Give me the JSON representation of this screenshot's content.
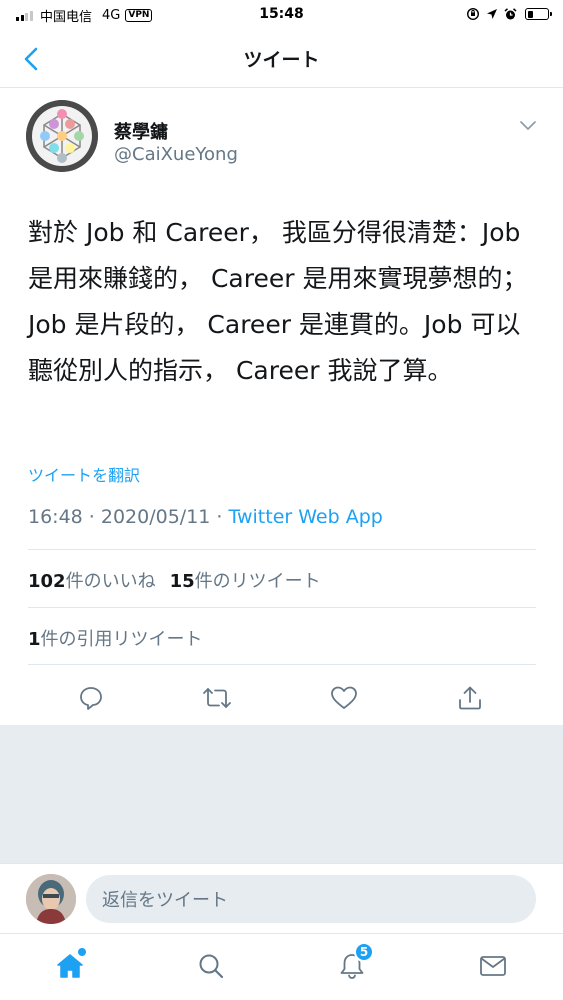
{
  "status_bar": {
    "carrier": "中国电信",
    "network": "4G",
    "vpn": "VPN",
    "time": "15:48"
  },
  "header": {
    "title": "ツイート",
    "back_icon": "chevron-left-icon"
  },
  "tweet": {
    "author_name": "蔡學鏞",
    "author_handle": "@CaiXueYong",
    "text": "對於 Job 和 Career， 我區分得很清楚：Job 是用來賺錢的， Career 是用來實現夢想的；Job 是片段的， Career 是連貫的。Job 可以聽從別人的指示， Career 我說了算。",
    "translate_label": "ツイートを翻訳",
    "timestamp": "16:48 · 2020/05/11 · ",
    "source": "Twitter Web App",
    "likes_count": "102",
    "likes_label": "件のいいね",
    "retweets_count": "15",
    "retweets_label": "件のリツイート",
    "quotes_count": "1",
    "quotes_label": "件の引用リツイート"
  },
  "actions": [
    "reply-icon",
    "retweet-icon",
    "like-icon",
    "share-icon"
  ],
  "reply": {
    "placeholder": "返信をツイート"
  },
  "tab_bar": {
    "items": [
      "home-icon",
      "search-icon",
      "notifications-icon",
      "messages-icon"
    ],
    "notifications_badge": "5"
  },
  "colors": {
    "accent": "#1da1f2",
    "text": "#14171a",
    "secondary": "#657786",
    "divider": "#e1e8ed",
    "background_gray": "#e6ecf0"
  }
}
